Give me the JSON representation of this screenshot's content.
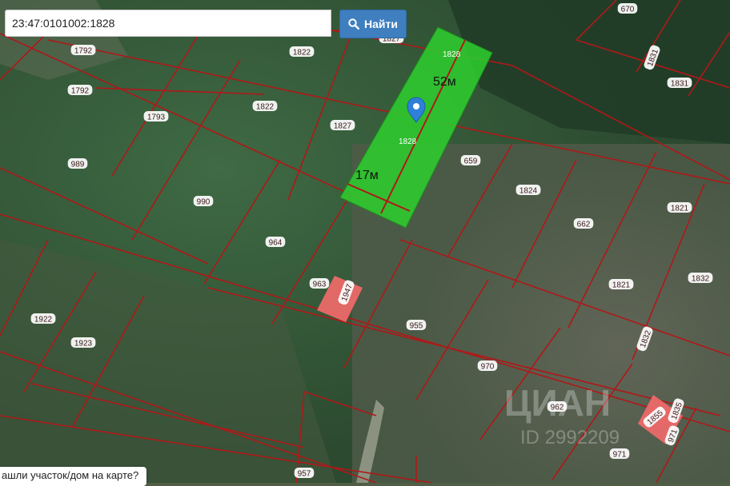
{
  "search": {
    "value": "23:47:0101002:1828",
    "button_label": "Найти",
    "button_icon": "search-icon"
  },
  "highlighted_plot": {
    "label_top": "1828",
    "label_center": "1828",
    "length_label": "52м",
    "width_label": "17м",
    "marker_icon": "location-pin-icon"
  },
  "bottom_link": "ашли участок/дом на карте?",
  "watermark": "ЦИАН\nID 2992209",
  "parcel_labels": [
    "670",
    "1792",
    "1822",
    "1827",
    "1831",
    "1792",
    "1822",
    "1831",
    "1793",
    "1827",
    "989",
    "659",
    "1824",
    "990",
    "1821",
    "662",
    "964",
    "963",
    "1947",
    "1821",
    "1832",
    "1922",
    "955",
    "1832",
    "1923",
    "970",
    "962",
    "1855",
    "1835",
    "971",
    "971",
    "957"
  ],
  "colors": {
    "boundary": "#b01818",
    "plot_fill": "#2ecc2e",
    "pink_plot": "#f06a6a",
    "search_button": "#3f7fbf"
  }
}
